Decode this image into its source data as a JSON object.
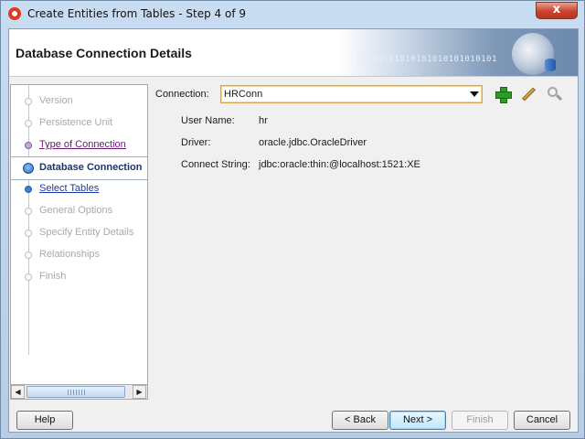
{
  "window": {
    "title": "Create Entities from Tables - Step 4 of 9",
    "close_glyph": "x"
  },
  "header": {
    "title": "Database Connection Details",
    "binary_art": "01010101010101010101010101"
  },
  "steps": [
    {
      "label": "Version",
      "state": "disabled"
    },
    {
      "label": "Persistence Unit",
      "state": "disabled"
    },
    {
      "label": "Type of Connection",
      "state": "visited"
    },
    {
      "label": "Database Connection",
      "state": "current"
    },
    {
      "label": "Select Tables",
      "state": "link"
    },
    {
      "label": "General Options",
      "state": "disabled"
    },
    {
      "label": "Specify Entity Details",
      "state": "disabled"
    },
    {
      "label": "Relationships",
      "state": "disabled"
    },
    {
      "label": "Finish",
      "state": "disabled"
    }
  ],
  "scrollbar": {
    "left_arrow": "◀",
    "right_arrow": "▶"
  },
  "connection": {
    "label": "Connection:",
    "value": "HRConn",
    "user_name_label": "User Name:",
    "user_name": "hr",
    "driver_label": "Driver:",
    "driver": "oracle.jdbc.OracleDriver",
    "connect_string_label": "Connect String:",
    "connect_string": "jdbc:oracle:thin:@localhost:1521:XE"
  },
  "buttons": {
    "help": "Help",
    "back": "< Back",
    "next": "Next >",
    "finish": "Finish",
    "cancel": "Cancel"
  }
}
